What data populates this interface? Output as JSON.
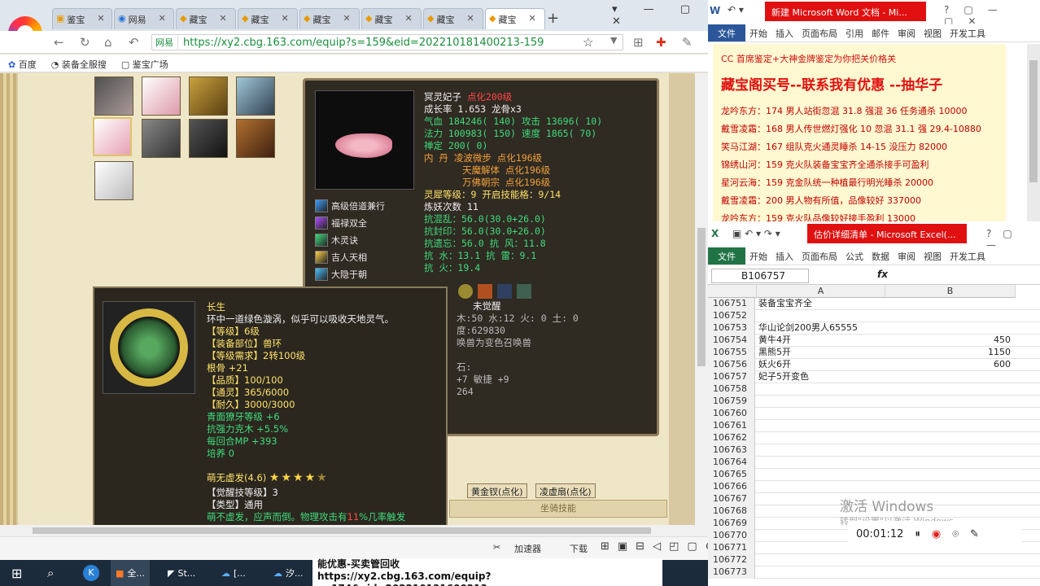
{
  "browser": {
    "tabs": [
      "鉴宝",
      "网易",
      "藏宝",
      "藏宝",
      "藏宝",
      "藏宝",
      "藏宝",
      "藏宝"
    ],
    "url_site": "网易",
    "url": "https://xy2.cbg.163.com/equip?s=159&eid=202210181400213-159",
    "bookmarks": [
      "百度",
      "装备全服搜",
      "鉴宝广场"
    ],
    "status_items": [
      "加速器",
      "下载"
    ]
  },
  "pet": {
    "name": "冥灵妃子",
    "dianhua": "点化200级",
    "growth": "成长率 1.653 龙骨x3",
    "qixue": "气血 184246( 140)",
    "gongji": "攻击 13696( 10)",
    "fali": "法力 100983( 150)",
    "sudu": "速度 1865( 70)",
    "chanding": "禅定 200( 0)",
    "neidan1": "内  丹 凌波微步 点化196级",
    "neidan2": "天魔解体 点化196级",
    "neidan3": "万佛朝宗 点化196级",
    "lingxi": "灵犀等级：9 开启技能格：9/14",
    "lianyao": "炼妖次数 11",
    "kang1": "抗混乱：56.0(30.0+26.0)",
    "kang2": "抗封印：56.0(30.0+26.0)",
    "kang3": "抗遗忘：56.0 抗  风：11.8",
    "kang4": "抗  水：13.1 抗  雷：9.1",
    "kang5": "抗  火：19.4",
    "skills": [
      "高级倍道兼行",
      "福禄双全",
      "木灵诀",
      "吉人天相",
      "大隐于朝"
    ],
    "awaken": "未觉醒",
    "frag1": "木:50 水:12 火: 0 土: 0",
    "frag2": "度:629830",
    "frag3": "唤兽为变色召唤兽",
    "frag4": "石:",
    "frag5": "+7 敏捷 +9",
    "frag6": "264"
  },
  "tooltip": {
    "name": "长生",
    "desc": "环中一道绿色漩涡，似乎可以吸收天地灵气。",
    "level": "【等级】6级",
    "part": "【装备部位】兽环",
    "req": "【等级需求】2转100级",
    "gengu": "根骨 +21",
    "quality": "【品质】100/100",
    "tongling": "【通灵】365/6000",
    "naijiu": "【耐久】3000/3000",
    "attr1": "青面獠牙等级 +6",
    "attr2": "抗强力克木 +5.5%",
    "attr3": "每回合MP +393",
    "peiyang": "培养 0",
    "skill_name": "萌无虚发(4.6)",
    "stars": "★★★★",
    "juexing": "【觉醒技等级】3",
    "type": "【类型】通用",
    "effect_a": "萌不虚发，应声而倒。物理攻击有",
    "effect_b": "11",
    "effect_c": "%几率触发"
  },
  "bottom_tabs": [
    "黄金钗(点化)",
    "凌虚扇(点化)"
  ],
  "riding": "坐骑技能",
  "word": {
    "title": "新建 Microsoft Word 文档 - Mi...",
    "ribbon": [
      "文件",
      "开始",
      "插入",
      "页面布局",
      "引用",
      "邮件",
      "审阅",
      "视图",
      "开发工具"
    ],
    "line0": "CC 首席鉴定+大神金牌鉴定为你把关价格关",
    "heading": "藏宝阁买号--联系我有优惠 --抽华子",
    "lines": [
      "龙吟东方：174 男人站街忽混 31.8 强混 36 任务通杀 10000",
      "戴雪凌霜：168 男人传世燃灯强化 10 忽混 31.1 强 29.4-10880",
      "笑马江湖：167 组队克火通灵睡杀 14-15 没压力 82000",
      "锦绣山河：159 克火队装备宝宝齐全通杀接手可盈利",
      "星河云海：159 克金队统一种植最行明光睡杀 20000",
      "戴雪凌霜：200 男人物有所值，品像较好 337000",
      "龙吟东方：159 克火队品像较好接手盈利 13000"
    ]
  },
  "excel": {
    "title": "估价详细清单 - Microsoft Excel(...",
    "ribbon": [
      "文件",
      "开始",
      "插入",
      "页面布局",
      "公式",
      "数据",
      "审阅",
      "视图",
      "开发工具"
    ],
    "namebox": "B106757",
    "fx": "fx",
    "col_a": "A",
    "col_b": "B",
    "rows": [
      {
        "n": "106751",
        "a": "装备宝宝齐全",
        "b": ""
      },
      {
        "n": "106752",
        "a": "",
        "b": ""
      },
      {
        "n": "106753",
        "a": "华山论剑200男人65555",
        "b": ""
      },
      {
        "n": "106754",
        "a": "黄牛4开",
        "b": "450"
      },
      {
        "n": "106755",
        "a": "黑熊5开",
        "b": "1150"
      },
      {
        "n": "106756",
        "a": "妖火6开",
        "b": "600"
      },
      {
        "n": "106757",
        "a": "妃子5开变色",
        "b": ""
      },
      {
        "n": "106758",
        "a": "",
        "b": ""
      },
      {
        "n": "106759",
        "a": "",
        "b": ""
      },
      {
        "n": "106760",
        "a": "",
        "b": ""
      },
      {
        "n": "106761",
        "a": "",
        "b": ""
      },
      {
        "n": "106762",
        "a": "",
        "b": ""
      },
      {
        "n": "106763",
        "a": "",
        "b": ""
      },
      {
        "n": "106764",
        "a": "",
        "b": ""
      },
      {
        "n": "106765",
        "a": "",
        "b": ""
      },
      {
        "n": "106766",
        "a": "",
        "b": ""
      },
      {
        "n": "106767",
        "a": "",
        "b": ""
      },
      {
        "n": "106768",
        "a": "",
        "b": ""
      },
      {
        "n": "106769",
        "a": "",
        "b": ""
      },
      {
        "n": "106770",
        "a": "",
        "b": ""
      },
      {
        "n": "106771",
        "a": "",
        "b": ""
      },
      {
        "n": "106772",
        "a": "",
        "b": ""
      },
      {
        "n": "106773",
        "a": "",
        "b": ""
      }
    ],
    "activate": "激活 Windows",
    "activate_sub": "转到\"设置\"以激活 Windows。",
    "timer": "00:01:12"
  },
  "taskbar": {
    "items": [
      "全...",
      "St...",
      "[...",
      "汐..."
    ],
    "popup_title": "能优惠-买卖管回收",
    "popup_url": "https://xy2.cbg.163.com/equip?s=174&eid=202210131600213-"
  },
  "colors": {
    "word_blue": "#2b579a",
    "excel_green": "#217346",
    "title_red": "#e01010",
    "pet_yellow": "#ffe16a",
    "pet_green": "#3fdc7c"
  }
}
